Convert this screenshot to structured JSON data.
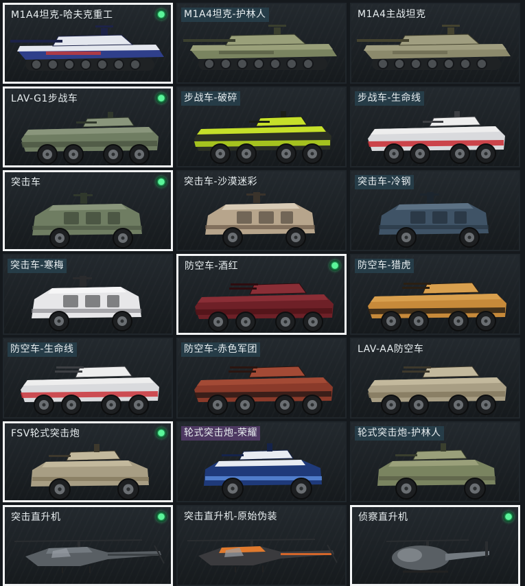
{
  "vehicles": [
    {
      "name": "M1A4坦克-哈夫克重工",
      "equipped": true,
      "selected": true,
      "label_style": "plain",
      "kind": "tank",
      "skin": "haavk",
      "icon": "tank-icon"
    },
    {
      "name": "M1A4坦克-护林人",
      "equipped": false,
      "selected": false,
      "label_style": "tint",
      "kind": "tank",
      "skin": "camo-green",
      "icon": "tank-icon"
    },
    {
      "name": "M1A4主战坦克",
      "equipped": false,
      "selected": false,
      "label_style": "plain",
      "kind": "tank",
      "skin": "olive",
      "icon": "tank-icon"
    },
    {
      "name": "LAV-G1步战车",
      "equipped": true,
      "selected": true,
      "label_style": "plain",
      "kind": "ifv",
      "skin": "green",
      "icon": "ifv-icon"
    },
    {
      "name": "步战车-破碎",
      "equipped": false,
      "selected": false,
      "label_style": "tint",
      "kind": "ifv",
      "skin": "lime",
      "icon": "ifv-icon"
    },
    {
      "name": "步战车-生命线",
      "equipped": false,
      "selected": false,
      "label_style": "tint",
      "kind": "ifv",
      "skin": "lifeline",
      "icon": "ifv-icon"
    },
    {
      "name": "突击车",
      "equipped": true,
      "selected": true,
      "label_style": "plain",
      "kind": "assault",
      "skin": "green",
      "icon": "assault-vehicle-icon"
    },
    {
      "name": "突击车-沙漠迷彩",
      "equipped": false,
      "selected": false,
      "label_style": "plain",
      "kind": "assault",
      "skin": "desert",
      "icon": "assault-vehicle-icon"
    },
    {
      "name": "突击车-冷钢",
      "equipped": false,
      "selected": false,
      "label_style": "tint",
      "kind": "assault",
      "skin": "steel",
      "icon": "assault-vehicle-icon"
    },
    {
      "name": "突击车-寒梅",
      "equipped": false,
      "selected": false,
      "label_style": "tint",
      "kind": "assault",
      "skin": "white",
      "icon": "assault-vehicle-icon"
    },
    {
      "name": "防空车-酒红",
      "equipped": true,
      "selected": true,
      "label_style": "plain",
      "kind": "aa",
      "skin": "wine",
      "icon": "aa-vehicle-icon"
    },
    {
      "name": "防空车-猎虎",
      "equipped": false,
      "selected": false,
      "label_style": "tint",
      "kind": "aa",
      "skin": "tiger",
      "icon": "aa-vehicle-icon"
    },
    {
      "name": "防空车-生命线",
      "equipped": false,
      "selected": false,
      "label_style": "tint",
      "kind": "aa",
      "skin": "lifeline",
      "icon": "aa-vehicle-icon"
    },
    {
      "name": "防空车-赤色军团",
      "equipped": false,
      "selected": false,
      "label_style": "tint",
      "kind": "aa",
      "skin": "redcamo",
      "icon": "aa-vehicle-icon"
    },
    {
      "name": "LAV-AA防空车",
      "equipped": false,
      "selected": false,
      "label_style": "plain",
      "kind": "aa",
      "skin": "sand",
      "icon": "aa-vehicle-icon"
    },
    {
      "name": "FSV轮式突击炮",
      "equipped": true,
      "selected": true,
      "label_style": "plain",
      "kind": "fsv",
      "skin": "sand",
      "icon": "assault-gun-icon"
    },
    {
      "name": "轮式突击炮-荣耀",
      "equipped": false,
      "selected": false,
      "label_style": "legend",
      "kind": "fsv",
      "skin": "glory",
      "icon": "assault-gun-icon"
    },
    {
      "name": "轮式突击炮-护林人",
      "equipped": false,
      "selected": false,
      "label_style": "tint",
      "kind": "fsv",
      "skin": "camo-green",
      "icon": "assault-gun-icon"
    },
    {
      "name": "突击直升机",
      "equipped": true,
      "selected": true,
      "label_style": "plain",
      "kind": "heli",
      "skin": "grey",
      "icon": "attack-helicopter-icon"
    },
    {
      "name": "突击直升机-原始伪装",
      "equipped": false,
      "selected": false,
      "label_style": "plain",
      "kind": "heli",
      "skin": "orange",
      "icon": "attack-helicopter-icon"
    },
    {
      "name": "侦察直升机",
      "equipped": true,
      "selected": true,
      "label_style": "plain",
      "kind": "scout",
      "skin": "grey",
      "icon": "scout-helicopter-icon"
    }
  ]
}
